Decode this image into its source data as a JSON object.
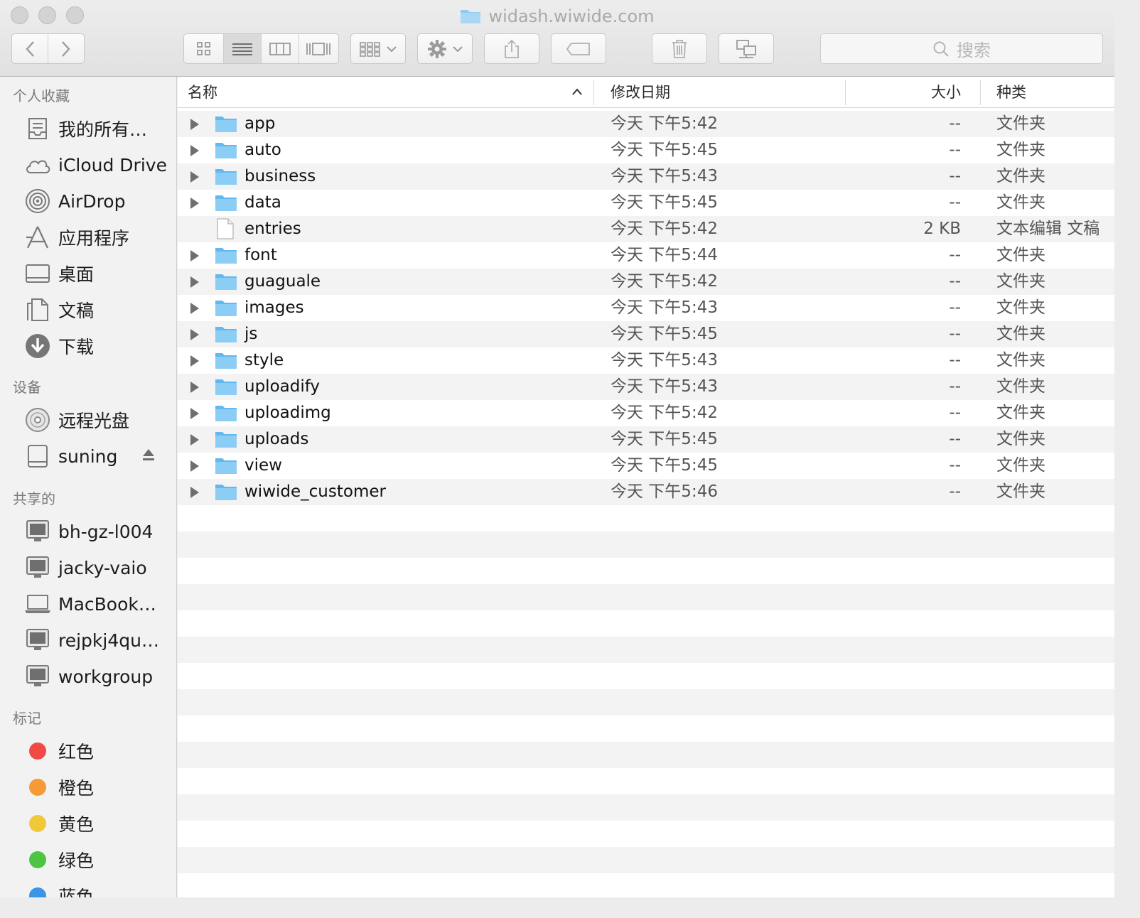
{
  "window": {
    "title": "widash.wiwide.com"
  },
  "toolbar": {
    "back_icon": "chevron-left-icon",
    "forward_icon": "chevron-right-icon",
    "view_modes": [
      "icon-view",
      "list-view",
      "column-view",
      "cover-flow-view"
    ],
    "active_view": "list-view",
    "search_placeholder": "搜索"
  },
  "sidebar": {
    "favorites_heading": "个人收藏",
    "favorites": [
      {
        "label": "我的所有…",
        "icon": "all-files-icon"
      },
      {
        "label": "iCloud Drive",
        "icon": "cloud-icon"
      },
      {
        "label": "AirDrop",
        "icon": "airdrop-icon"
      },
      {
        "label": "应用程序",
        "icon": "applications-icon"
      },
      {
        "label": "桌面",
        "icon": "desktop-icon"
      },
      {
        "label": "文稿",
        "icon": "documents-icon"
      },
      {
        "label": "下载",
        "icon": "downloads-icon"
      }
    ],
    "devices_heading": "设备",
    "devices": [
      {
        "label": "远程光盘",
        "icon": "disc-icon"
      },
      {
        "label": "suning",
        "icon": "drive-icon"
      }
    ],
    "shared_heading": "共享的",
    "shared": [
      {
        "label": "bh-gz-l004",
        "icon": "monitor-icon"
      },
      {
        "label": "jacky-vaio",
        "icon": "monitor-icon"
      },
      {
        "label": "MacBook…",
        "icon": "laptop-icon"
      },
      {
        "label": "rejpkj4qu…",
        "icon": "monitor-icon"
      },
      {
        "label": "workgroup",
        "icon": "monitor-icon"
      }
    ],
    "tags_heading": "标记",
    "tags": [
      {
        "label": "红色",
        "color": "#f14a45"
      },
      {
        "label": "橙色",
        "color": "#f59a37"
      },
      {
        "label": "黄色",
        "color": "#f2c83b"
      },
      {
        "label": "绿色",
        "color": "#4ec542"
      },
      {
        "label": "蓝色",
        "color": "#3a94e8"
      }
    ]
  },
  "columns": {
    "name": "名称",
    "date": "修改日期",
    "size": "大小",
    "kind": "种类"
  },
  "files": [
    {
      "name": "app",
      "date": "今天 下午5:42",
      "size": "--",
      "kind": "文件夹",
      "type": "folder"
    },
    {
      "name": "auto",
      "date": "今天 下午5:45",
      "size": "--",
      "kind": "文件夹",
      "type": "folder"
    },
    {
      "name": "business",
      "date": "今天 下午5:43",
      "size": "--",
      "kind": "文件夹",
      "type": "folder"
    },
    {
      "name": "data",
      "date": "今天 下午5:45",
      "size": "--",
      "kind": "文件夹",
      "type": "folder"
    },
    {
      "name": "entries",
      "date": "今天 下午5:42",
      "size": "2 KB",
      "kind": "文本编辑 文稿",
      "type": "file"
    },
    {
      "name": "font",
      "date": "今天 下午5:44",
      "size": "--",
      "kind": "文件夹",
      "type": "folder"
    },
    {
      "name": "guaguale",
      "date": "今天 下午5:42",
      "size": "--",
      "kind": "文件夹",
      "type": "folder"
    },
    {
      "name": "images",
      "date": "今天 下午5:43",
      "size": "--",
      "kind": "文件夹",
      "type": "folder"
    },
    {
      "name": "js",
      "date": "今天 下午5:45",
      "size": "--",
      "kind": "文件夹",
      "type": "folder"
    },
    {
      "name": "style",
      "date": "今天 下午5:43",
      "size": "--",
      "kind": "文件夹",
      "type": "folder"
    },
    {
      "name": "uploadify",
      "date": "今天 下午5:43",
      "size": "--",
      "kind": "文件夹",
      "type": "folder"
    },
    {
      "name": "uploadimg",
      "date": "今天 下午5:42",
      "size": "--",
      "kind": "文件夹",
      "type": "folder"
    },
    {
      "name": "uploads",
      "date": "今天 下午5:45",
      "size": "--",
      "kind": "文件夹",
      "type": "folder"
    },
    {
      "name": "view",
      "date": "今天 下午5:45",
      "size": "--",
      "kind": "文件夹",
      "type": "folder"
    },
    {
      "name": "wiwide_customer",
      "date": "今天 下午5:46",
      "size": "--",
      "kind": "文件夹",
      "type": "folder"
    }
  ]
}
